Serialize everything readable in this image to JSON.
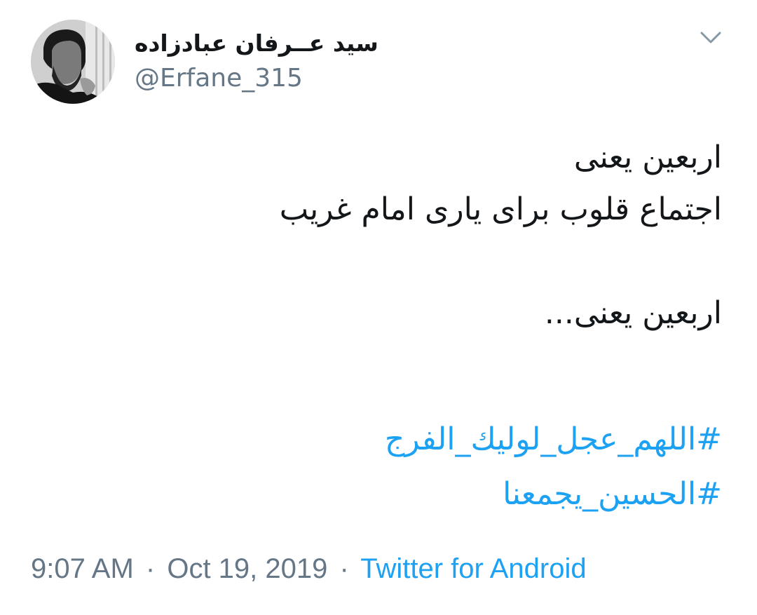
{
  "tweet": {
    "author": {
      "display_name": "سید عــرفان عبادزاده",
      "handle": "@Erfane_315",
      "avatar_icon": "user-avatar-photo"
    },
    "menu_icon": "chevron-down-icon",
    "body_lines": [
      "اربعین یعنی",
      "اجتماع قلوب برای یاری امام غریب",
      "",
      "اربعین یعنی..."
    ],
    "hashtags": [
      "#اللهم_عجل_لوليك_الفرج",
      "#الحسين_يجمعنا"
    ],
    "meta": {
      "time": "9:07 AM",
      "separator": "·",
      "date": "Oct 19, 2019",
      "source": "Twitter for Android"
    },
    "colors": {
      "link": "#1da1f2",
      "secondary": "#657786",
      "text": "#14171a"
    }
  }
}
